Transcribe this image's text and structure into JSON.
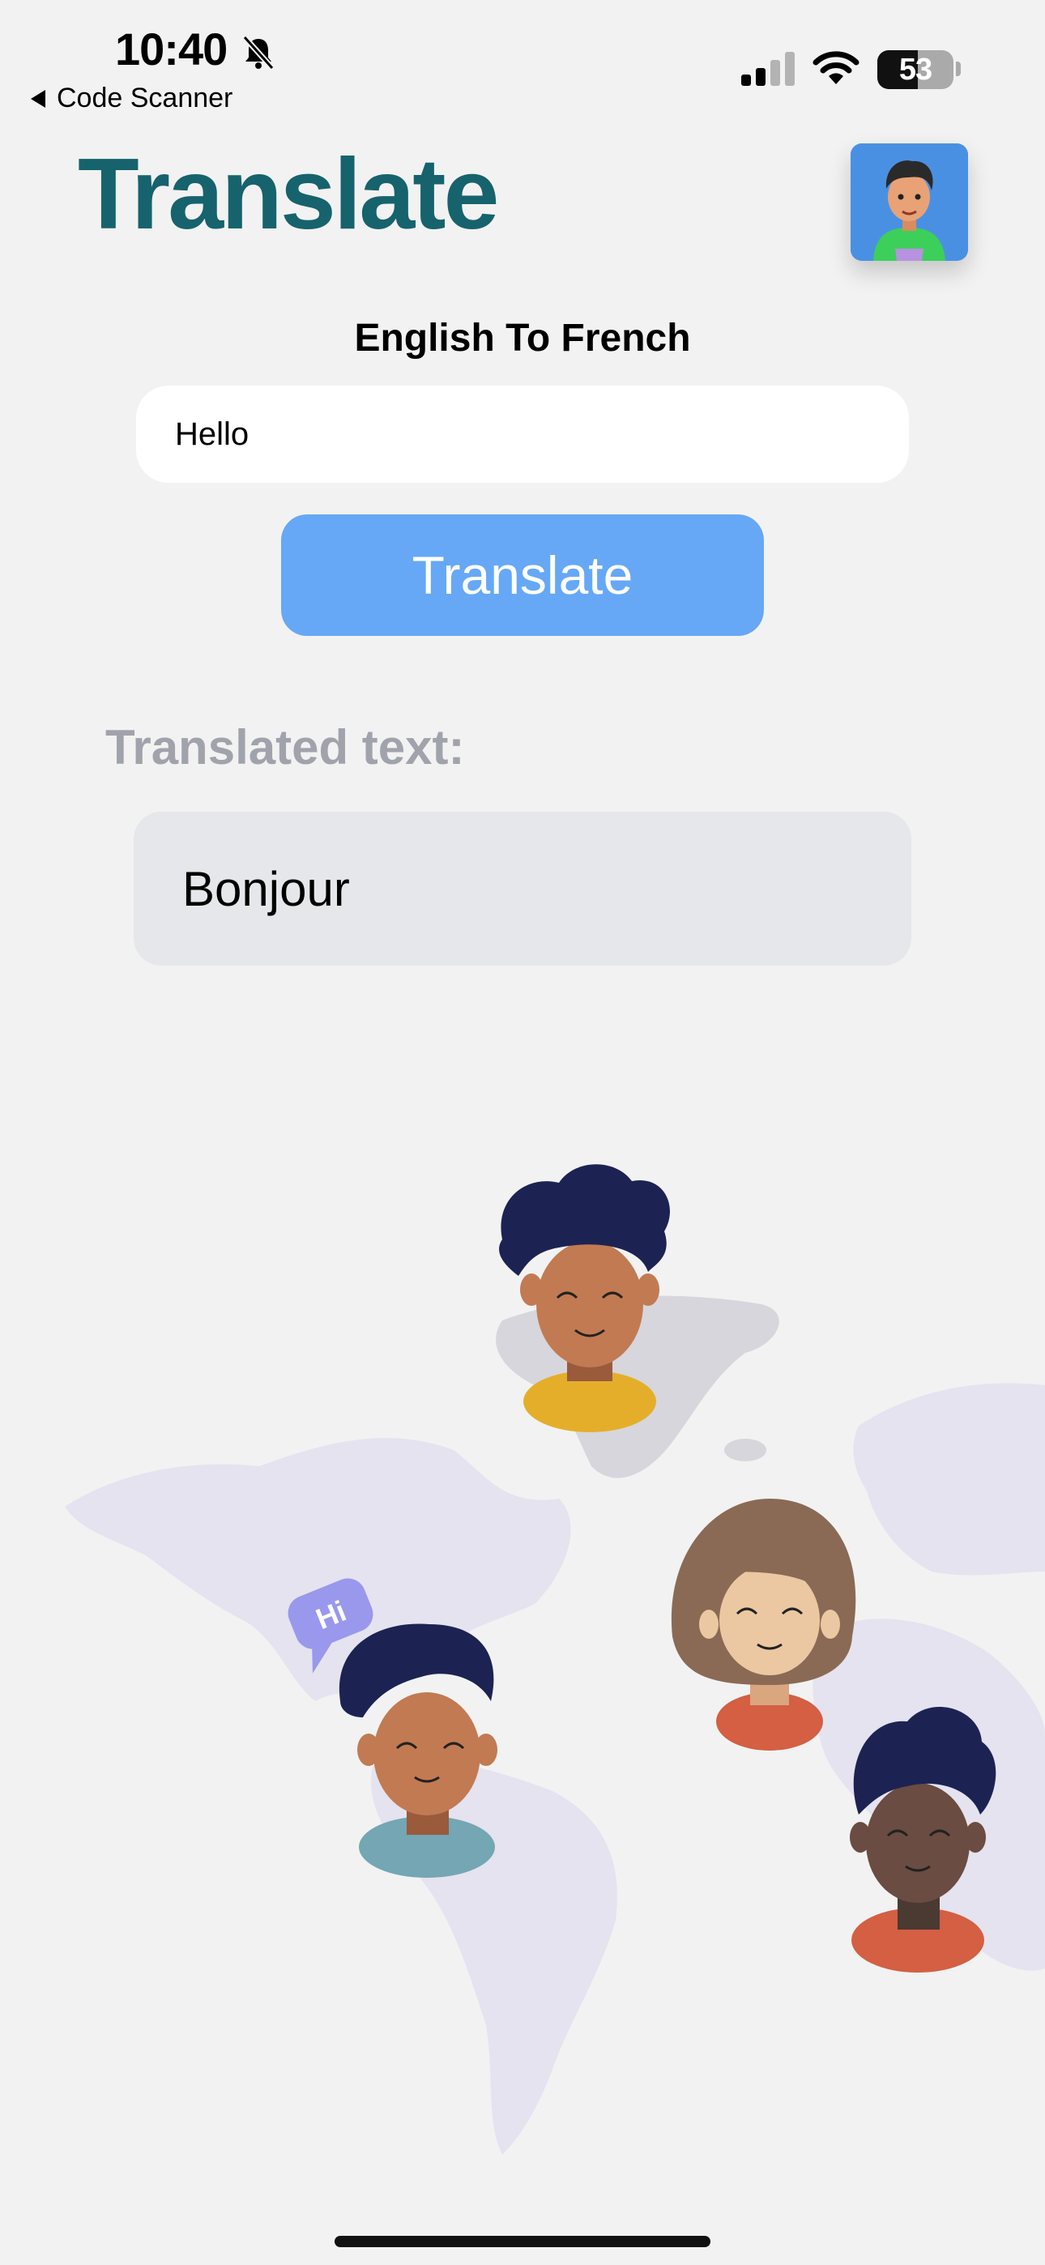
{
  "status_bar": {
    "time": "10:40",
    "back_label": "Code Scanner",
    "battery_level": "53",
    "battery_fraction": 0.53
  },
  "header": {
    "title": "Translate"
  },
  "translator": {
    "direction_label": "English To French",
    "input_value": "Hello",
    "button_label": "Translate",
    "result_label": "Translated text:",
    "result_value": "Bonjour"
  },
  "illustration": {
    "speech_bubble_text": "Hi"
  },
  "colors": {
    "title": "#16636d",
    "button": "#66a8f5",
    "result_bg": "#e6e7ea",
    "label_gray": "#a1a3ac"
  },
  "icons": {
    "bell": "bell-slash-icon",
    "signal": "cellular-signal-icon",
    "wifi": "wifi-icon",
    "battery": "battery-icon",
    "back": "back-triangle-icon"
  }
}
